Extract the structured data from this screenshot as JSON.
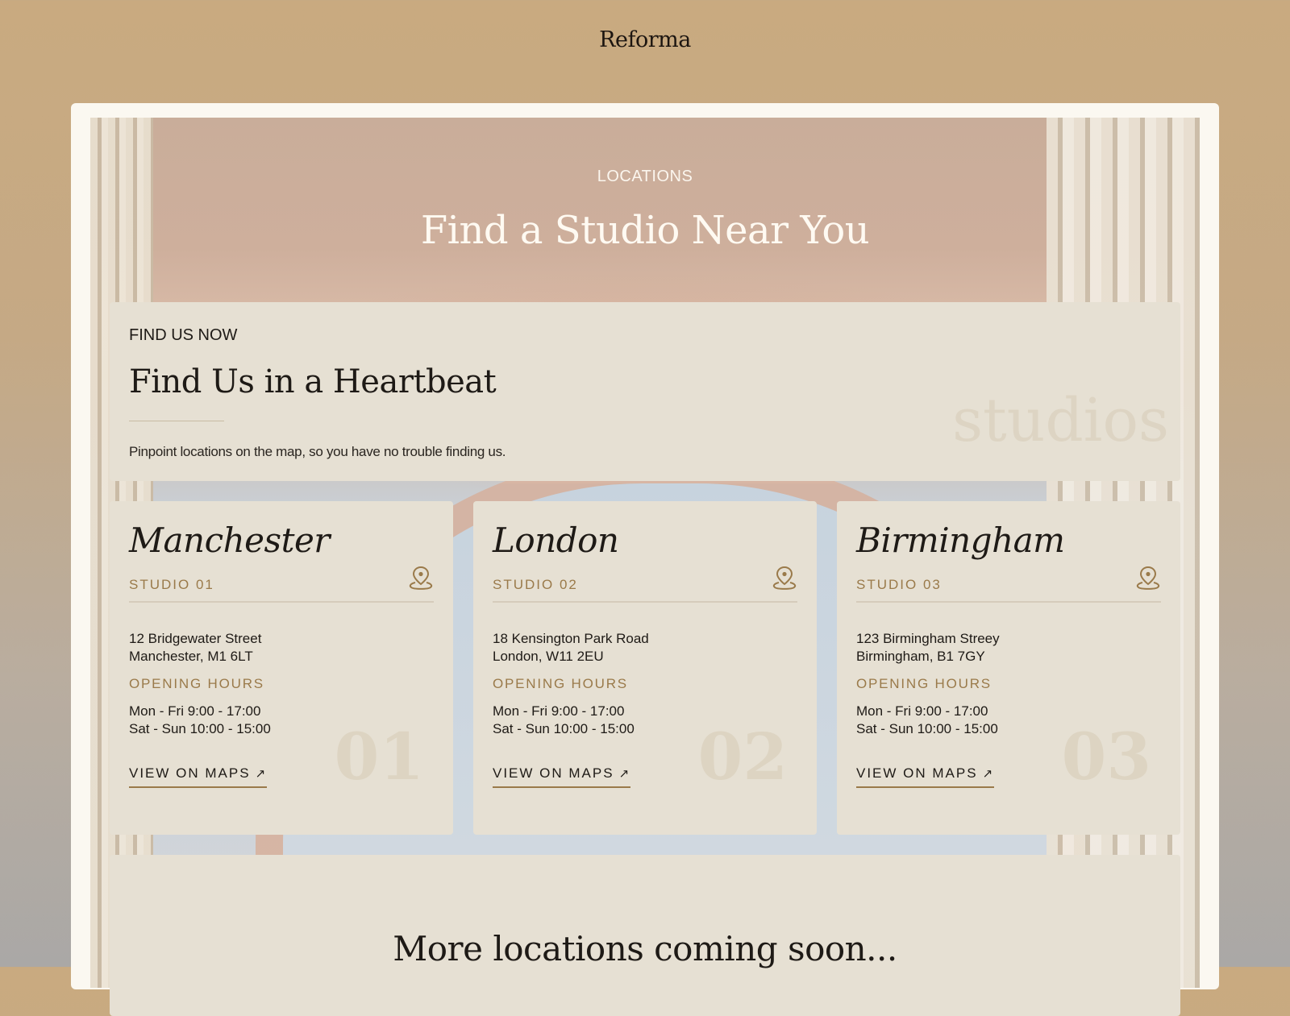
{
  "brand": {
    "name": "Reforma"
  },
  "hero": {
    "eyebrow": "LOCATIONS",
    "title": "Find a Studio Near You"
  },
  "intro": {
    "eyebrow": "FIND US NOW",
    "title": "Find Us in a Heartbeat",
    "text": "Pinpoint locations on the map, so you have no trouble finding us.",
    "watermark": "studios"
  },
  "studios": [
    {
      "city": "Manchester",
      "studio": "STUDIO 01",
      "address_line1": "12 Bridgewater Street",
      "address_line2": "Manchester, M1 6LT",
      "hours_label": "OPENING HOURS",
      "hours_line1": "Mon - Fri 9:00 - 17:00",
      "hours_line2": "Sat - Sun 10:00 - 15:00",
      "number": "01",
      "link_label": "VIEW ON MAPS",
      "link_icon": "arrow-up-right-icon",
      "pin_icon": "map-pin-icon"
    },
    {
      "city": "London",
      "studio": "STUDIO 02",
      "address_line1": "18 Kensington Park Road",
      "address_line2": "London, W11 2EU",
      "hours_label": "OPENING HOURS",
      "hours_line1": "Mon - Fri 9:00 - 17:00",
      "hours_line2": "Sat - Sun 10:00 - 15:00",
      "number": "02",
      "link_label": "VIEW ON MAPS",
      "link_icon": "arrow-up-right-icon",
      "pin_icon": "map-pin-icon"
    },
    {
      "city": "Birmingham",
      "studio": "STUDIO 03",
      "address_line1": "123 Birmingham Streey",
      "address_line2": "Birmingham, B1 7GY",
      "hours_label": "OPENING HOURS",
      "hours_line1": "Mon - Fri 9:00 - 17:00",
      "hours_line2": "Sat - Sun 10:00 - 15:00",
      "number": "03",
      "link_label": "VIEW ON MAPS",
      "link_icon": "arrow-up-right-icon",
      "pin_icon": "map-pin-icon"
    }
  ],
  "more": {
    "title": "More locations coming soon..."
  },
  "colors": {
    "accent": "#9a7a4a",
    "card_bg": "#e6e0d3",
    "frame_bg": "#fbf8f1",
    "text": "#1e1a16"
  }
}
